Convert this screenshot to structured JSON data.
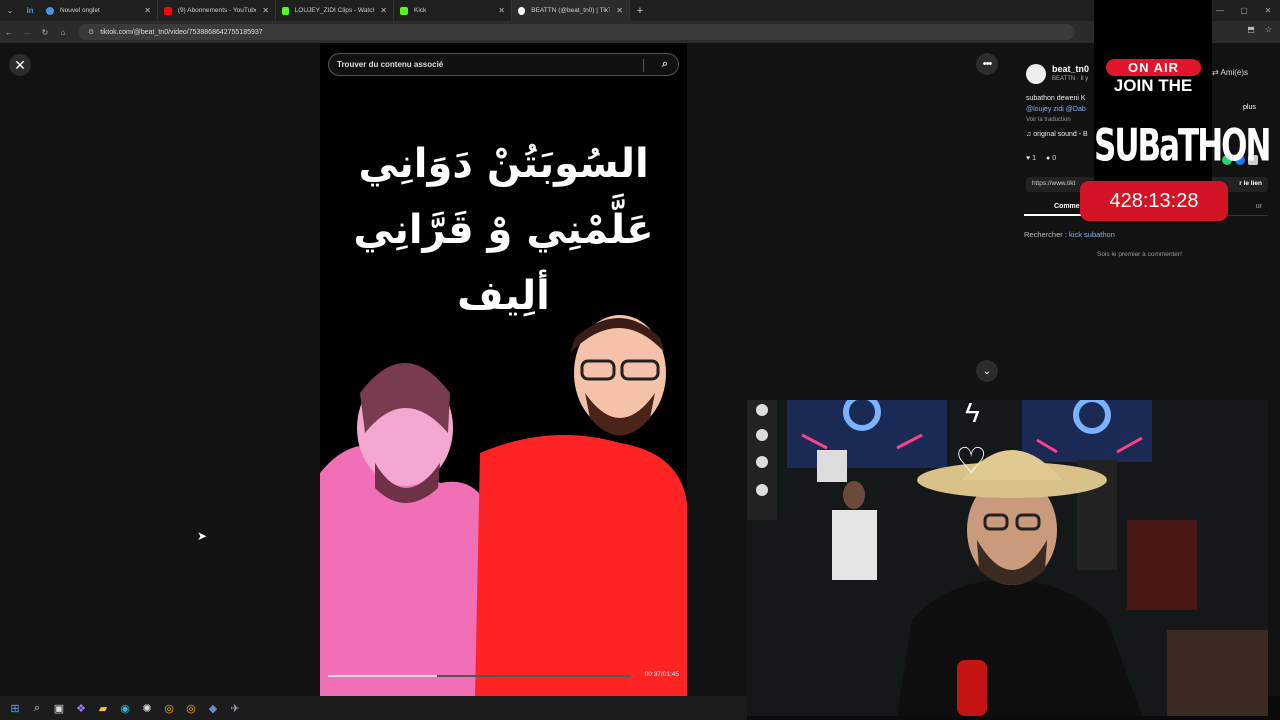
{
  "browser": {
    "tabs": [
      {
        "title": "Nouvel onglet",
        "color": "#4a90e2",
        "active": false
      },
      {
        "title": "(9) Abonnements - YouTube",
        "color": "#ff0000",
        "active": false
      },
      {
        "title": "LOUJEY_ZIDI Clips - Watch Live",
        "color": "#53fc18",
        "active": false
      },
      {
        "title": "Kick",
        "color": "#53fc18",
        "active": false
      },
      {
        "title": "BEATTN (@beat_tn0) | TikTok",
        "color": "#ffffff",
        "active": true
      }
    ],
    "url": "tiktok.com/@beat_tn0/video/7538868642755185937"
  },
  "video": {
    "search_placeholder": "Trouver du contenu associé",
    "caption_line1": "السُوبَتُنْ دَوَانِي",
    "caption_line2": "عَلَّمْنِي وْ قَرَّانِي",
    "caption_line3": "ألِيف",
    "time": "00:37/01:45",
    "progress": 0.36
  },
  "post": {
    "username": "beat_tn0",
    "display": "BEATTN · Il y",
    "friends": "Ami(e)s",
    "desc_line1": "subathon deweni K",
    "mentions": "@loujey zidi @Dab",
    "translate": "Voir la traduction",
    "sound": "original sound - B",
    "more": "plus",
    "likes": "1",
    "comments": "0",
    "link": "https://www.tikt",
    "copy_link": "r le lien",
    "tab_comments": "Comme",
    "tab_creator": "ur",
    "related_label": "Rechercher :",
    "related_keyword": "kick subathon",
    "no_comments": "Sois le premier à commenter!"
  },
  "overlay": {
    "on_air": "ON AIR",
    "join": "JOIN THE",
    "subathon": "SUBaTHON",
    "timer": "428:13:28"
  },
  "colors": {
    "accent_red": "#e2162a",
    "link_blue": "#7cb4ff"
  }
}
